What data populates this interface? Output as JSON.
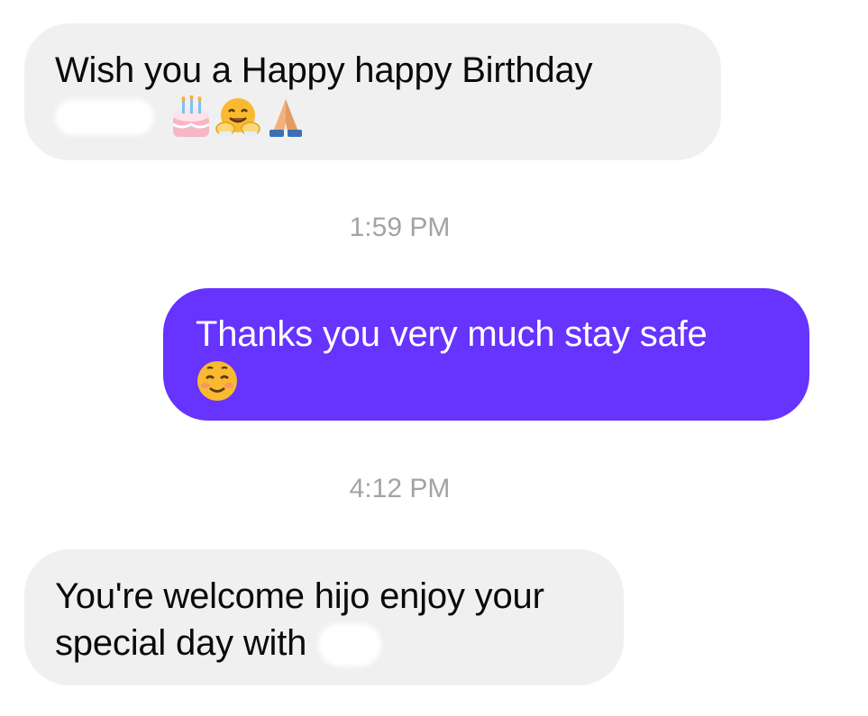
{
  "conversation": {
    "messages": [
      {
        "direction": "incoming",
        "lines": [
          "Wish you a Happy happy Birthday"
        ],
        "emojis": [
          "birthday-cake-icon",
          "hugging-face-icon",
          "folded-hands-icon"
        ]
      },
      {
        "direction": "outgoing",
        "lines": [
          "Thanks you very much stay safe"
        ],
        "emojis": [
          "smiling-face-icon"
        ]
      },
      {
        "direction": "incoming",
        "lines": [
          "You're welcome hijo enjoy your",
          "special day with"
        ]
      }
    ],
    "timestamps": [
      "1:59 PM",
      "4:12 PM"
    ]
  },
  "colors": {
    "incoming_bubble": "#f0f0f0",
    "outgoing_bubble": "#6633ff",
    "timestamp_text": "#a3a3a3"
  }
}
